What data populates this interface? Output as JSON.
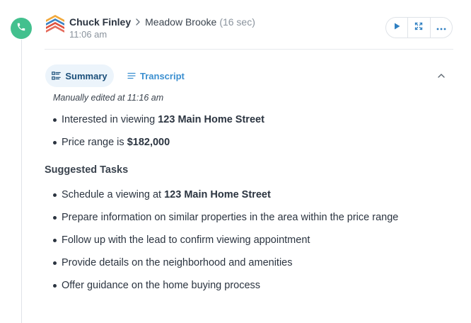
{
  "call": {
    "caller": "Chuck Finley",
    "contact": "Meadow Brooke",
    "duration": "(16 sec)",
    "time": "11:06 am"
  },
  "icons": {
    "call_badge": "phone-icon",
    "avatar": "company-logo-icon",
    "separator": "chevron-right-icon",
    "play": "play-icon",
    "expand": "expand-icon",
    "more": "more-horizontal-icon",
    "summary_tab": "summary-list-icon",
    "transcript_tab": "transcript-lines-icon",
    "collapse": "chevron-up-icon"
  },
  "tabs": {
    "summary_label": "Summary",
    "transcript_label": "Transcript"
  },
  "summary": {
    "edited_note": "Manually edited at 11:16 am",
    "points": [
      {
        "text": "Interested in viewing ",
        "bold": "123 Main Home Street"
      },
      {
        "text": "Price range is ",
        "bold": "$182,000"
      }
    ]
  },
  "tasks": {
    "title": "Suggested Tasks",
    "items": [
      {
        "text": "Schedule a viewing at ",
        "bold": "123 Main Home Street"
      },
      {
        "text": "Prepare information on similar properties in the area within the price range"
      },
      {
        "text": "Follow up with the lead to confirm viewing appointment"
      },
      {
        "text": "Provide details on the neighborhood and amenities"
      },
      {
        "text": "Offer guidance on the home buying process"
      }
    ]
  },
  "colors": {
    "call_badge": "#43c08e",
    "accent_blue": "#3b8fd0",
    "active_tab_bg": "#ecf4fb",
    "active_tab_text": "#1b4f7a"
  }
}
